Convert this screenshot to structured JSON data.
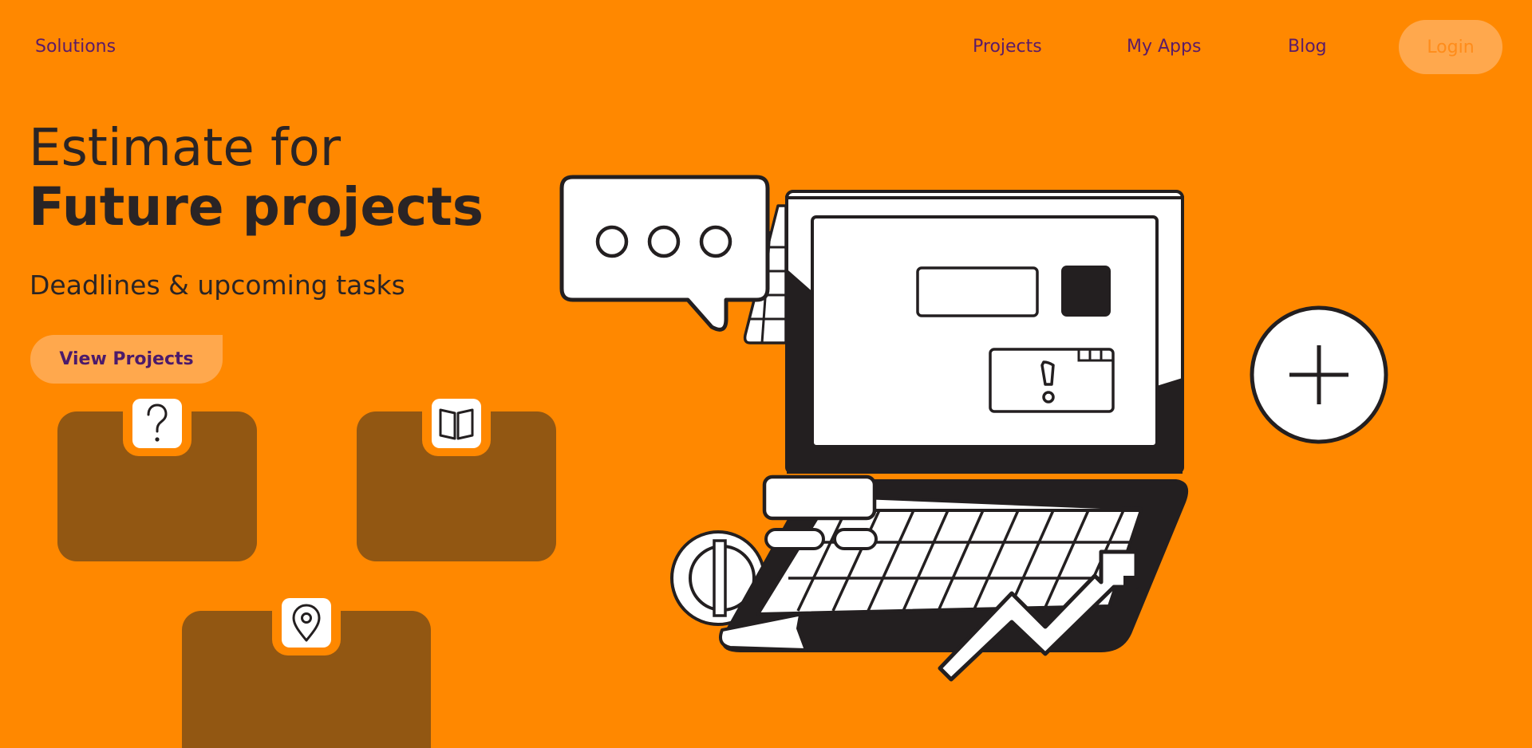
{
  "nav": {
    "solutions": "Solutions",
    "projects": "Projects",
    "my_apps": "My Apps",
    "blog": "Blog",
    "login": "Login"
  },
  "hero": {
    "title_line1": "Estimate for",
    "title_line2": "Future projects",
    "subtitle": "Deadlines & upcoming tasks",
    "cta": "View Projects"
  },
  "cards": [
    {
      "icon": "question-icon"
    },
    {
      "icon": "book-icon"
    },
    {
      "icon": "location-pin-icon"
    }
  ],
  "colors": {
    "background": "#FF8800",
    "nav_text": "#5B1B68",
    "button_bg": "#FFA84D",
    "card_bg": "#925712",
    "ink": "#231F20"
  }
}
